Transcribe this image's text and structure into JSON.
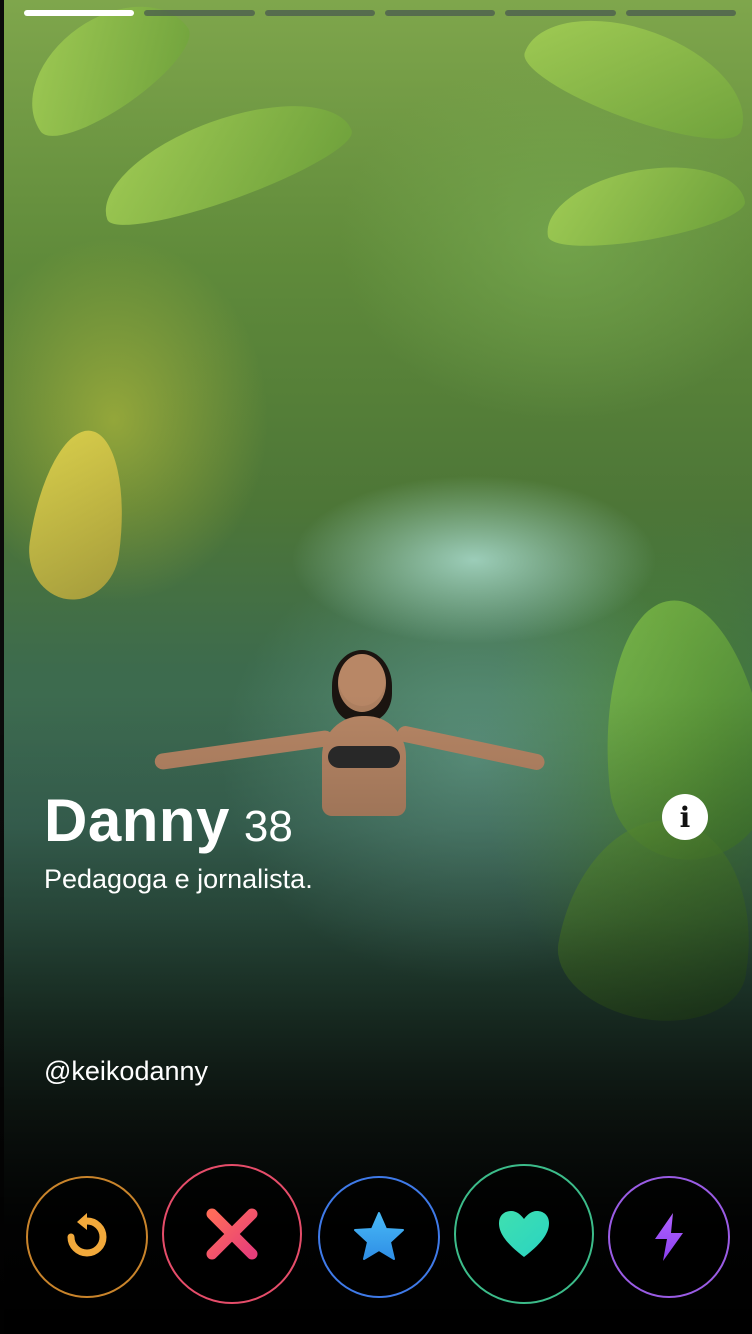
{
  "profile": {
    "name": "Danny",
    "age": "38",
    "bio": "Pedagoga e jornalista.",
    "handle": "@keikodanny"
  },
  "photo_progress": {
    "total": 6,
    "active_index": 0
  },
  "icons": {
    "info": "info-icon",
    "rewind": "rewind-icon",
    "nope": "close-icon",
    "super_like": "star-icon",
    "like": "heart-icon",
    "boost": "lightning-icon"
  },
  "colors": {
    "rewind": "#f2a93b",
    "nope": "#f0506e",
    "super_like": "#3aa7f0",
    "like": "#3fe0b0",
    "boost": "#a45cff"
  }
}
